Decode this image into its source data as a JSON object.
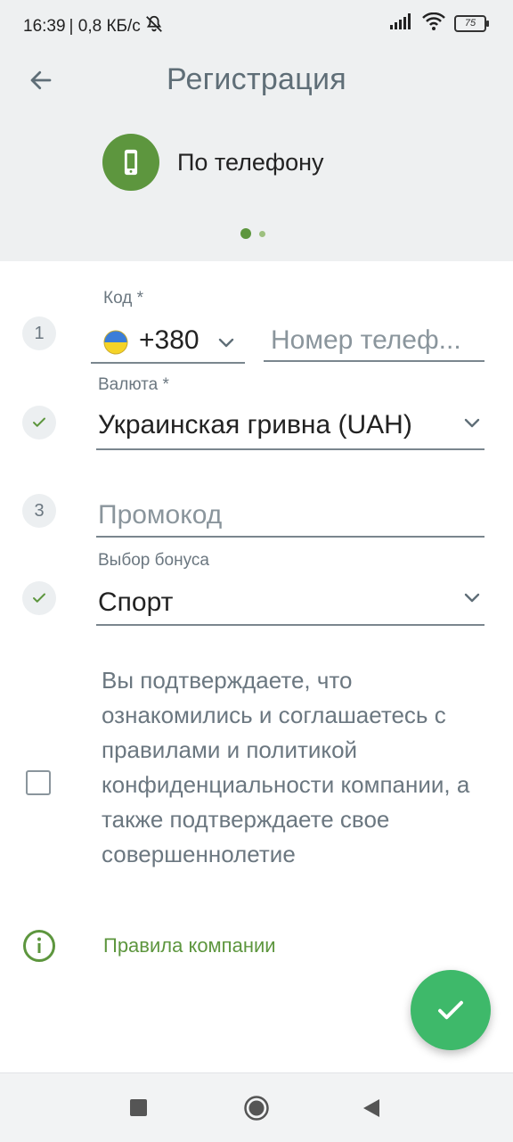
{
  "status_bar": {
    "time": "16:39",
    "network_speed": "| 0,8 КБ/с",
    "battery": "75"
  },
  "header": {
    "title": "Регистрация",
    "method_label": "По телефону",
    "page_dots": {
      "active_index": 0,
      "total": 2
    }
  },
  "form": {
    "phone": {
      "step": "1",
      "code_label": "Код *",
      "code_value": "+380",
      "number_placeholder": "Номер телеф..."
    },
    "currency": {
      "label": "Валюта *",
      "value": "Украинская гривна (UAH)",
      "status": "done"
    },
    "promo": {
      "step": "3",
      "placeholder": "Промокод"
    },
    "bonus": {
      "label": "Выбор бонуса",
      "value": "Спорт",
      "status": "done"
    }
  },
  "consent": {
    "checked": false,
    "text": "Вы подтверждаете, что ознакомились и соглашаетесь с правилами и политикой конфиденциальности компании, а также подтверждаете свое совершеннолетие"
  },
  "rules_link": "Правила компании",
  "colors": {
    "brand_green": "#5d963e",
    "fab_green": "#3eb96a",
    "header_bg": "#eef0f1"
  },
  "icons": [
    "arrow-back-icon",
    "phone-icon",
    "ukraine-flag-icon",
    "chevron-down-icon",
    "check-icon",
    "info-icon",
    "square-nav-icon",
    "circle-nav-icon",
    "triangle-back-nav-icon"
  ]
}
